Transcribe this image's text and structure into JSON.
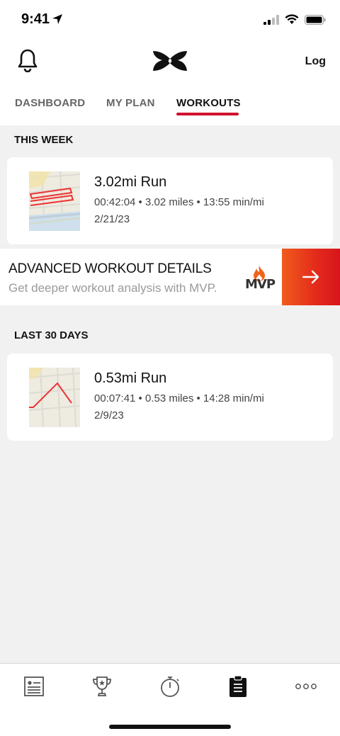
{
  "status_bar": {
    "time": "9:41"
  },
  "header": {
    "log_label": "Log"
  },
  "tabs": [
    {
      "label": "DASHBOARD",
      "active": false
    },
    {
      "label": "MY PLAN",
      "active": false
    },
    {
      "label": "WORKOUTS",
      "active": true
    }
  ],
  "this_week": {
    "title": "THIS WEEK",
    "workouts": [
      {
        "title": "3.02mi Run",
        "meta": "00:42:04 • 3.02 miles • 13:55 min/mi",
        "date": "2/21/23"
      }
    ]
  },
  "banner": {
    "title": "ADVANCED WORKOUT DETAILS",
    "subtitle": "Get deeper workout analysis with MVP.",
    "logo_text": "MVP"
  },
  "last_30_days": {
    "title": "LAST 30 DAYS",
    "workouts": [
      {
        "title": "0.53mi Run",
        "meta": "00:07:41 • 0.53 miles • 14:28 min/mi",
        "date": "2/9/23"
      }
    ]
  },
  "bottom_nav": {
    "items": [
      "feed",
      "challenges",
      "record",
      "workouts",
      "more"
    ],
    "active": "workouts"
  },
  "colors": {
    "accent": "#d0102a",
    "banner_orange": "#f05a1c"
  }
}
